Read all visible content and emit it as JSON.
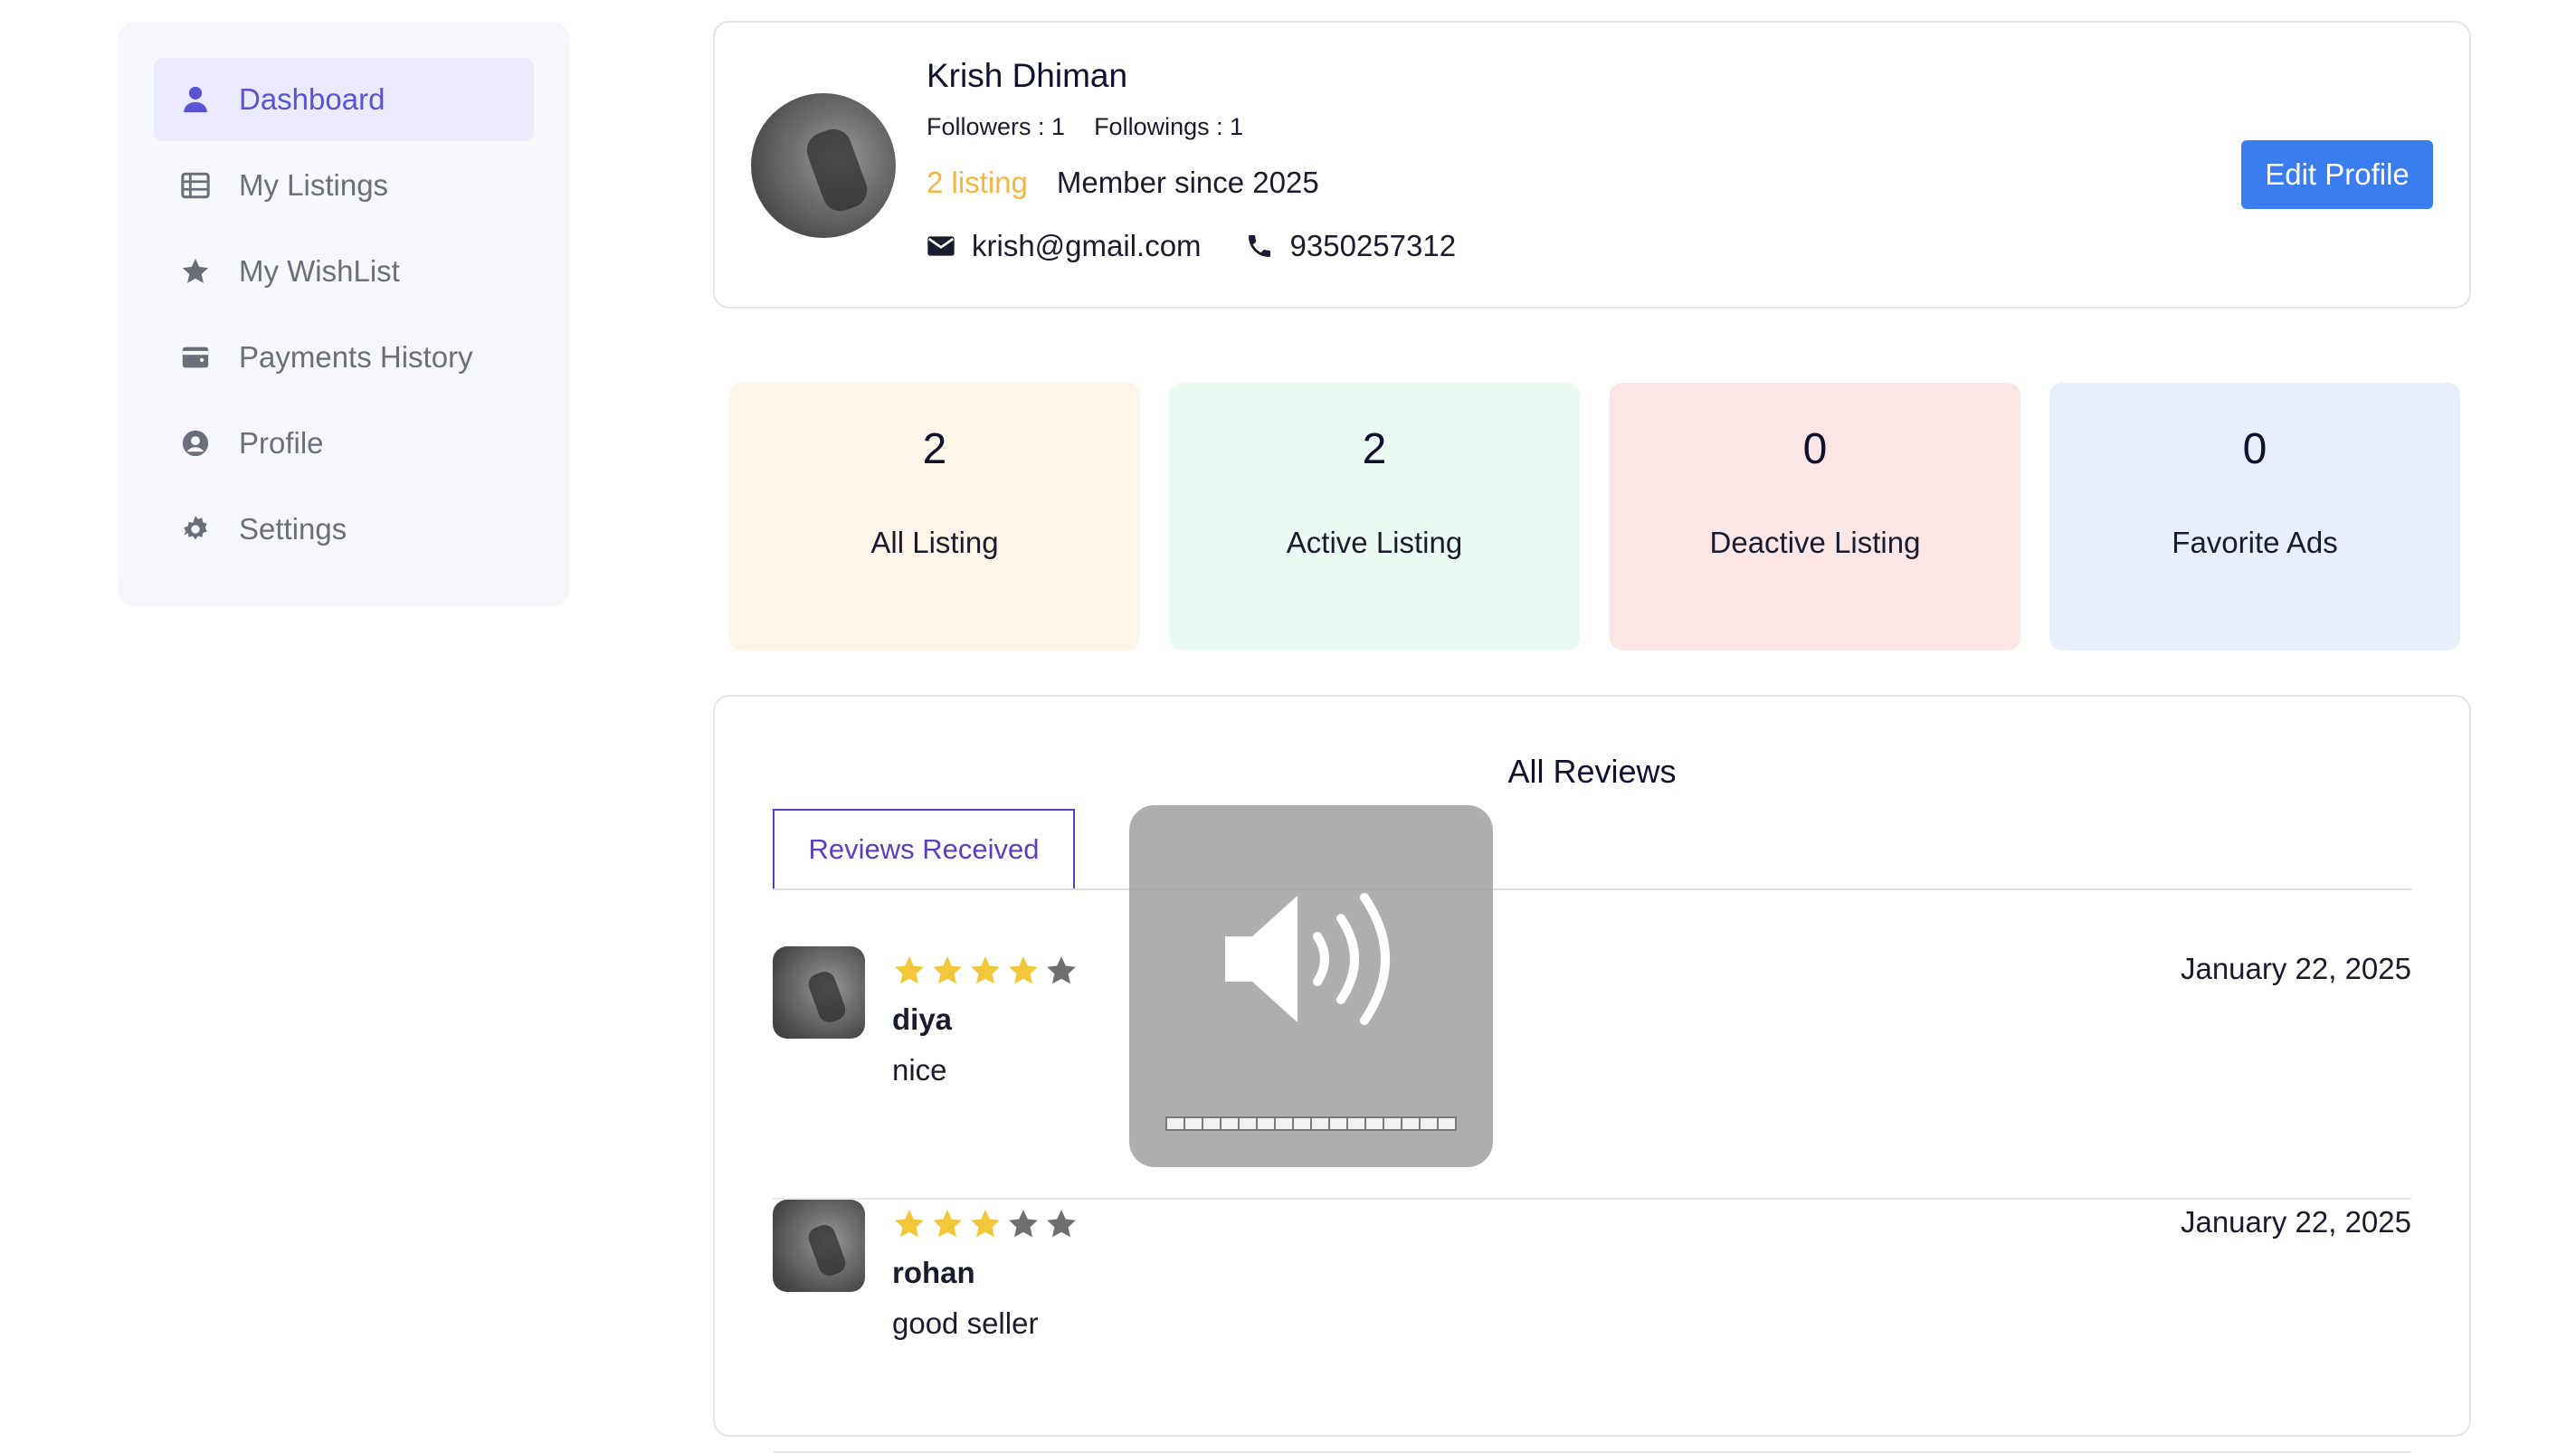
{
  "sidebar": {
    "items": [
      {
        "label": "Dashboard",
        "icon": "user-icon",
        "active": true
      },
      {
        "label": "My Listings",
        "icon": "list-icon",
        "active": false
      },
      {
        "label": "My WishList",
        "icon": "star-icon",
        "active": false
      },
      {
        "label": "Payments History",
        "icon": "wallet-icon",
        "active": false
      },
      {
        "label": "Profile",
        "icon": "user-circle-icon",
        "active": false
      },
      {
        "label": "Settings",
        "icon": "gear-icon",
        "active": false
      }
    ]
  },
  "profile": {
    "name": "Krish Dhiman",
    "followers": "Followers : 1",
    "followings": "Followings : 1",
    "listing_count": "2 listing",
    "member_since": "Member since 2025",
    "email": "krish@gmail.com",
    "phone": "9350257312",
    "edit_label": "Edit Profile"
  },
  "stats": [
    {
      "value": "2",
      "label": "All Listing",
      "color": "#fdf5e7"
    },
    {
      "value": "2",
      "label": "Active Listing",
      "color": "#e9fbf2"
    },
    {
      "value": "0",
      "label": "Deactive Listing",
      "color": "#fbe6e5"
    },
    {
      "value": "0",
      "label": "Favorite Ads",
      "color": "#e7effd"
    }
  ],
  "reviews": {
    "title": "All Reviews",
    "tab_label": "Reviews Received",
    "items": [
      {
        "name": "diya",
        "text": "nice",
        "date": "January 22, 2025",
        "rating": 4
      },
      {
        "name": "rohan",
        "text": "good seller",
        "date": "January 22, 2025",
        "rating": 3
      }
    ]
  },
  "volume_overlay": {
    "icon": "speaker-volume-icon",
    "level": 1.0,
    "segments": 16
  },
  "colors": {
    "accent": "#5a54d4",
    "button": "#3a7df0",
    "star_filled": "#f4c63a",
    "star_empty": "#6f6f6f",
    "listing_highlight": "#f4b73f"
  }
}
